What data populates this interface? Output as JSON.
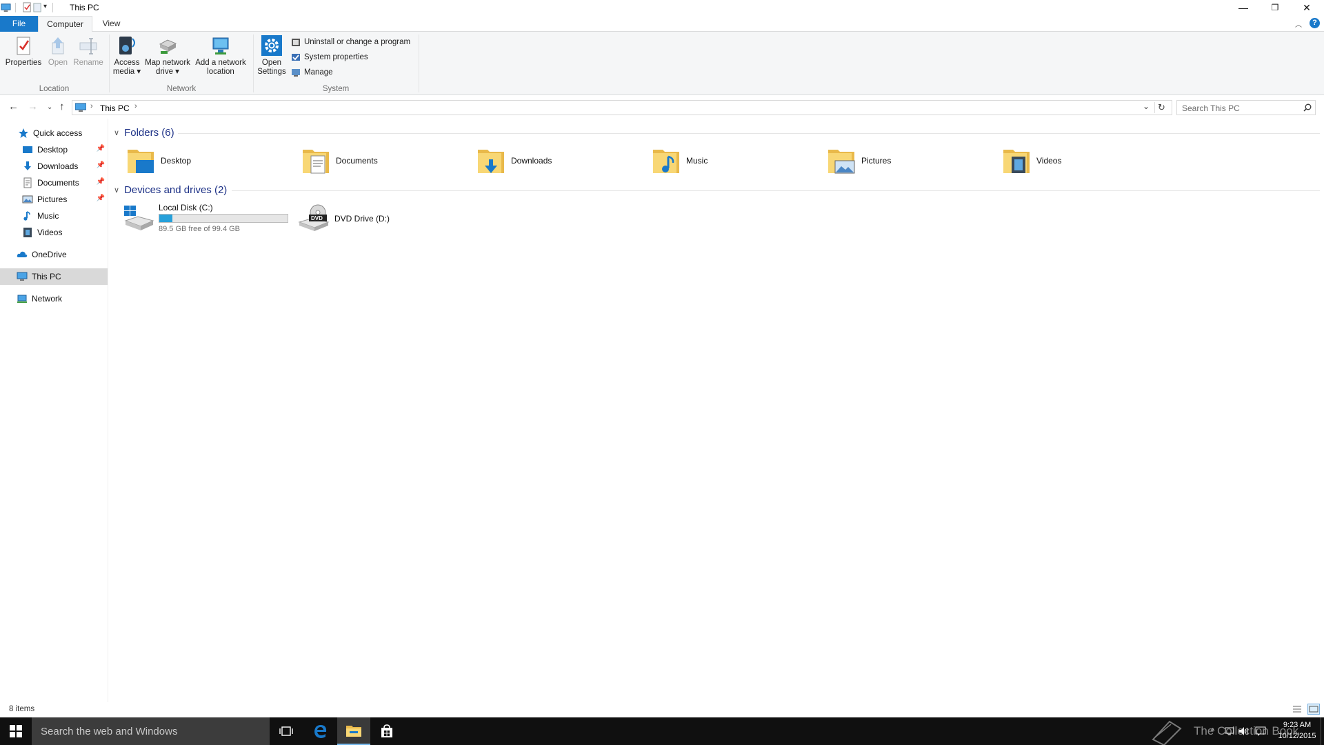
{
  "window": {
    "title": "This PC",
    "controls": {
      "minimize": "—",
      "restore": "❐",
      "close": "✕"
    }
  },
  "ribbon_tabs": [
    {
      "label": "File"
    },
    {
      "label": "Computer"
    },
    {
      "label": "View"
    }
  ],
  "ribbon": {
    "location": {
      "group_label": "Location",
      "properties": "Properties",
      "open": "Open",
      "rename": "Rename"
    },
    "network": {
      "group_label": "Network",
      "access_media_1": "Access",
      "access_media_2": "media",
      "map_drive_1": "Map network",
      "map_drive_2": "drive",
      "add_location_1": "Add a network",
      "add_location_2": "location"
    },
    "system": {
      "group_label": "System",
      "open_settings_1": "Open",
      "open_settings_2": "Settings",
      "uninstall": "Uninstall or change a program",
      "system_properties": "System properties",
      "manage": "Manage"
    }
  },
  "address_bar": {
    "path": "This PC",
    "search_placeholder": "Search This PC"
  },
  "sidebar": {
    "quick_access": "Quick access",
    "items": [
      {
        "label": "Desktop",
        "pinned": true
      },
      {
        "label": "Downloads",
        "pinned": true
      },
      {
        "label": "Documents",
        "pinned": true
      },
      {
        "label": "Pictures",
        "pinned": true
      },
      {
        "label": "Music",
        "pinned": false
      },
      {
        "label": "Videos",
        "pinned": false
      }
    ],
    "onedrive": "OneDrive",
    "this_pc": "This PC",
    "network": "Network"
  },
  "folders_section": {
    "header": "Folders (6)",
    "items": [
      "Desktop",
      "Documents",
      "Downloads",
      "Music",
      "Pictures",
      "Videos"
    ]
  },
  "drives_section": {
    "header": "Devices and drives (2)",
    "local_disk": {
      "name": "Local Disk (C:)",
      "free_text": "89.5 GB free of 99.4 GB",
      "used_fraction": 0.1
    },
    "dvd": {
      "name": "DVD Drive (D:)",
      "badge": "DVD"
    }
  },
  "status": {
    "item_count": "8 items"
  },
  "taskbar": {
    "search_placeholder": "Search the web and Windows",
    "time": "9:23 AM",
    "date": "10/12/2015",
    "watermark": "The Collection Book"
  },
  "colors": {
    "accent": "#1979ca",
    "section_header": "#1e3287",
    "folder_yellow": "#f8d775",
    "progress_fill": "#26a0da"
  }
}
